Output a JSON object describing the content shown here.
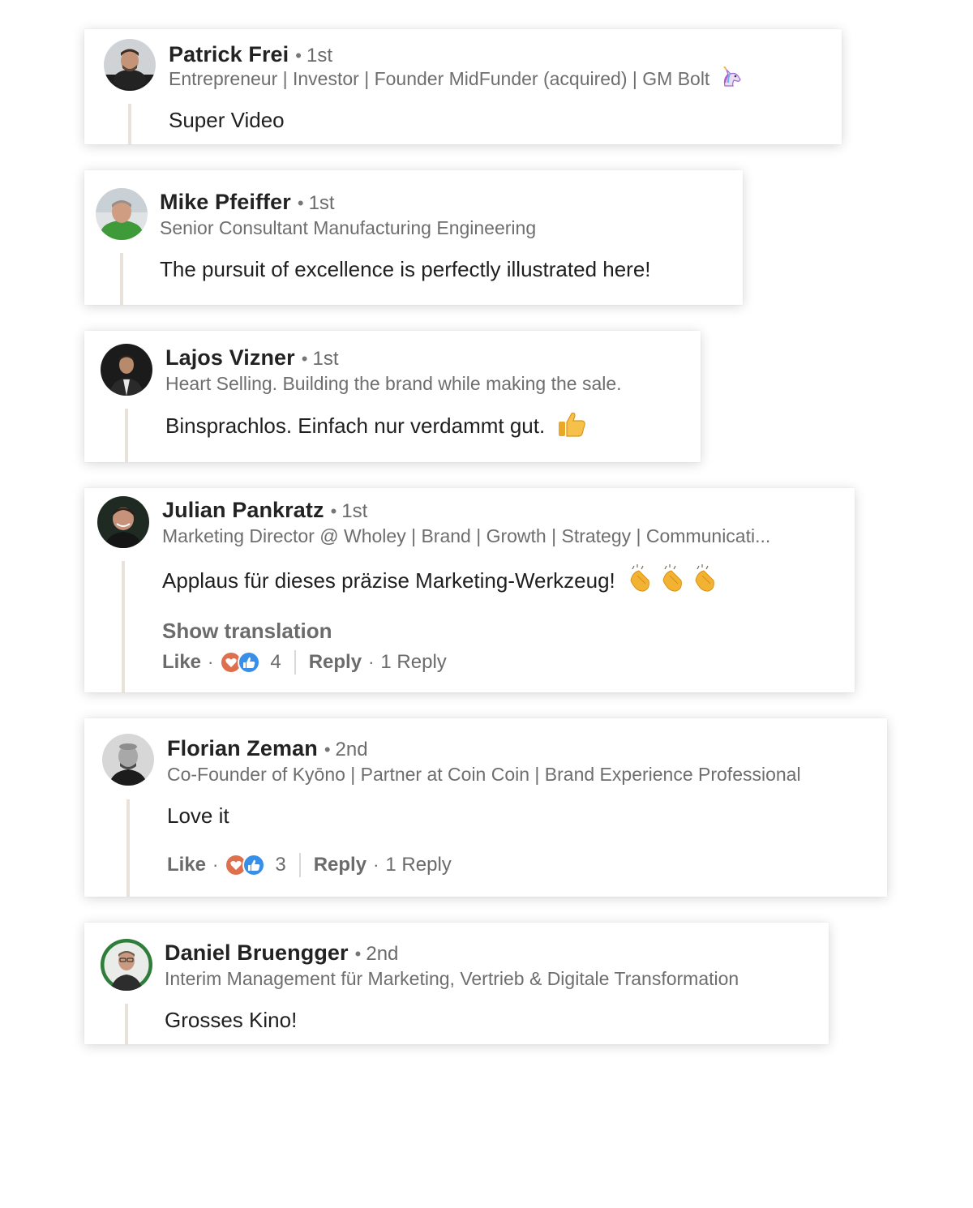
{
  "comments": [
    {
      "name": "Patrick Frei",
      "separator": "•",
      "degree": "1st",
      "headline": "Entrepreneur | Investor | Founder MidFunder (acquired) | GM Bolt",
      "headline_emoji": "unicorn-icon",
      "text": "Super Video"
    },
    {
      "name": "Mike Pfeiffer",
      "separator": "•",
      "degree": "1st",
      "headline": "Senior Consultant Manufacturing Engineering",
      "text": "The pursuit of excellence is perfectly illustrated here!"
    },
    {
      "name": "Lajos Vizner",
      "separator": "•",
      "degree": "1st",
      "headline": "Heart Selling. Building the brand while making the sale.",
      "text": "Binsprachlos. Einfach nur verdammt gut.",
      "text_emoji": "thumbs-up-icon"
    },
    {
      "name": "Julian Pankratz",
      "separator": "•",
      "degree": "1st",
      "headline": "Marketing Director @ Wholey | Brand | Growth | Strategy | Communicati...",
      "text": "Applaus für dieses präzise Marketing-Werkzeug!",
      "text_emoji": "clapping-hands-icon",
      "show_translation": "Show translation",
      "like_label": "Like",
      "reaction_count": "4",
      "reply_label": "Reply",
      "reply_count": "1 Reply"
    },
    {
      "name": "Florian Zeman",
      "separator": "•",
      "degree": "2nd",
      "headline": "Co-Founder of Kyōno | Partner at Coin Coin | Brand Experience Professional",
      "text": "Love it",
      "like_label": "Like",
      "reaction_count": "3",
      "reply_label": "Reply",
      "reply_count": "1 Reply"
    },
    {
      "name": "Daniel Bruengger",
      "separator": "•",
      "degree": "2nd",
      "headline": "Interim Management für Marketing, Vertrieb & Digitale Transformation",
      "text": "Grosses Kino!"
    }
  ],
  "separators": {
    "action_dot": "·"
  },
  "colors": {
    "name_text": "#222222",
    "meta_text": "#6b6b6b",
    "thread_line": "#e8e2da",
    "reaction_love": "#df704d",
    "reaction_like": "#378fe9"
  }
}
